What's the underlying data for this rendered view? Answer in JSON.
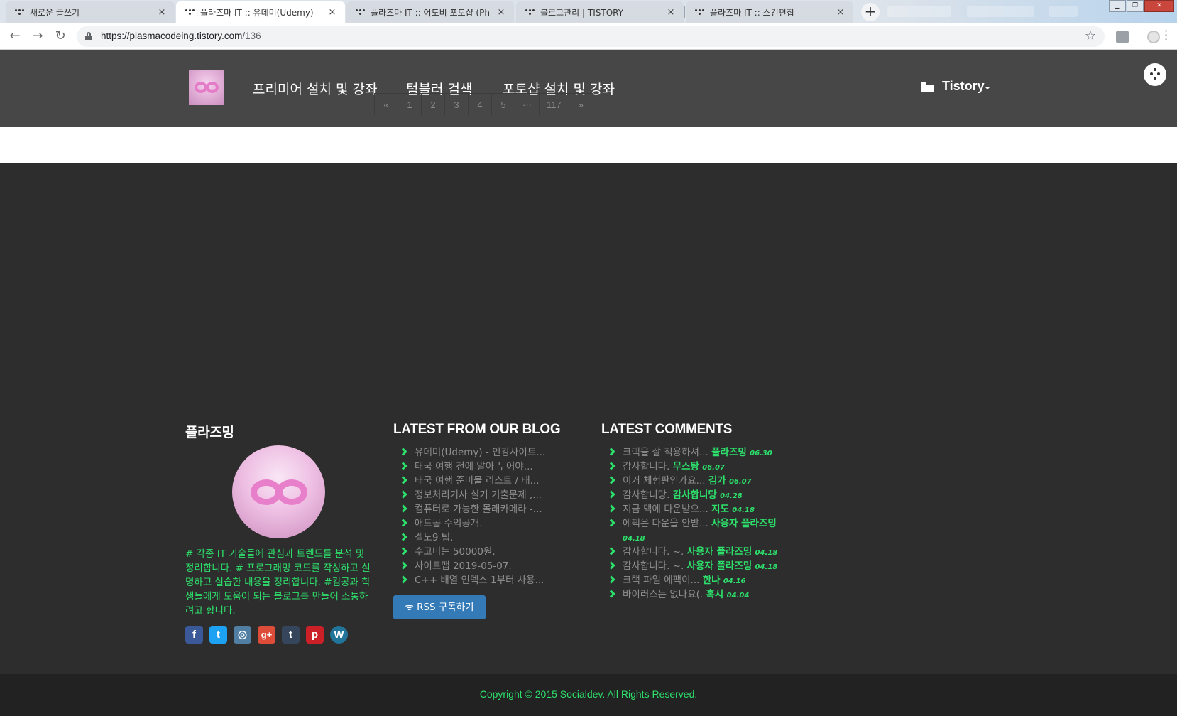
{
  "browser": {
    "tabs": [
      {
        "title": "새로운 글쓰기",
        "close": "×"
      },
      {
        "title": "플라즈마 IT :: 유데미(Udemy) - ",
        "close": "×"
      },
      {
        "title": "플라즈마 IT :: 어도비 포토샵 (Ph",
        "close": "×"
      },
      {
        "title": "블로그관리 | TISTORY",
        "close": "×"
      },
      {
        "title": "플라즈마 IT :: 스킨편집",
        "close": "×"
      }
    ],
    "new_tab": "+",
    "url_host": "https://plasmacodeing.tistory.com",
    "url_path": "/136",
    "back": "←",
    "forward": "→",
    "reload": "↻",
    "star": "☆"
  },
  "header": {
    "nav": [
      "프리미어 설치 및 강좌",
      "텀블러 검색",
      "포토샵 설치 및 강좌"
    ],
    "pagination": [
      "«",
      "1",
      "2",
      "3",
      "4",
      "5",
      "···",
      "117",
      "»"
    ],
    "menu_label": "Tistory"
  },
  "footer": {
    "about": {
      "title": "플라즈밍",
      "description": "# 각종 IT 기술들에 관심과 트렌드를 분석 및 정리합니다. # 프로그래밍 코드를 작성하고 설명하고 실습한 내용을 정리합니다. #컴공과 학생들에게 도움이 되는 블로그를 만들어 소통하려고 합니다.",
      "social": [
        {
          "icon": "facebook-icon",
          "glyph": "f",
          "color": "#3b5998"
        },
        {
          "icon": "twitter-icon",
          "glyph": "t",
          "color": "#1da1f2"
        },
        {
          "icon": "instagram-icon",
          "glyph": "◎",
          "color": "#517fa4"
        },
        {
          "icon": "google-plus-icon",
          "glyph": "g+",
          "color": "#dd4b39"
        },
        {
          "icon": "tumblr-icon",
          "glyph": "t",
          "color": "#35465c"
        },
        {
          "icon": "pinterest-icon",
          "glyph": "p",
          "color": "#cb2027"
        },
        {
          "icon": "wordpress-icon",
          "glyph": "W",
          "color": "#21759b"
        }
      ]
    },
    "blog": {
      "title": "LATEST FROM OUR BLOG",
      "posts": [
        "유데미(Udemy) - 인강사이트...",
        "태국 여행 전에 알아 두어야...",
        "태국 여행 준비물 리스트 / 태...",
        "정보처리기사 실기 기출문제 ,...",
        "컴퓨터로 가능한 몰래카메라 -...",
        "애드몹 수익공개.",
        "겔노9 팁.",
        "수고비는 50000원.",
        "사이트맵 2019-05-07.",
        "C++ 배열 인덱스 1부터 사용..."
      ],
      "rss_label": "RSS 구독하기"
    },
    "comments": {
      "title": "LATEST COMMENTS",
      "items": [
        {
          "text": "크랙을 잘 적용하셔...",
          "author": "플라즈밍",
          "date": "06.30"
        },
        {
          "text": "감사합니다.",
          "author": "무스탕",
          "date": "06.07"
        },
        {
          "text": "이거 체험판인가요...",
          "author": "김가",
          "date": "06.07"
        },
        {
          "text": "감사합니당.",
          "author": "감사합니당",
          "date": "04.28"
        },
        {
          "text": "지금 맥에 다운받으...",
          "author": "지도",
          "date": "04.18"
        },
        {
          "text": "에팩은 다운을 안받...",
          "author": "사용자 플라즈밍",
          "date": "04.18"
        },
        {
          "text": "감사합니다. ~.",
          "author": "사용자 플라즈밍",
          "date": "04.18"
        },
        {
          "text": "감사합니다. ~.",
          "author": "사용자 플라즈밍",
          "date": "04.18"
        },
        {
          "text": "크랙 파일 에팩이...",
          "author": "한나",
          "date": "04.16"
        },
        {
          "text": "바이러스는 없나요(.",
          "author": "혹시",
          "date": "04.04"
        }
      ]
    },
    "copyright": "Copyright © 2015 Socialdev. All Rights Reserved."
  },
  "colors": {
    "accent_green": "#2de06b",
    "header_bg": "#474747",
    "body_bg": "#2d2d2d",
    "rss_blue": "#337ab7"
  }
}
